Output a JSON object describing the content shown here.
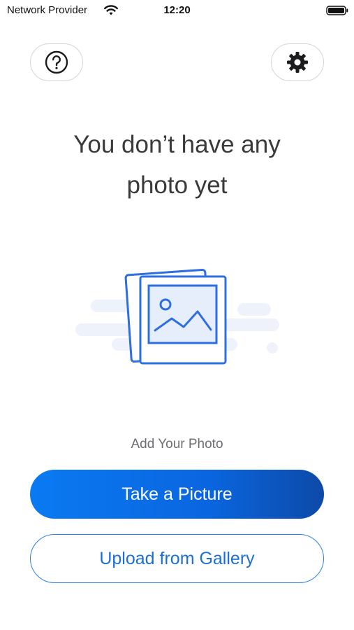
{
  "status_bar": {
    "carrier": "Network Provider",
    "time": "12:20",
    "wifi_icon": "wifi-icon",
    "battery_icon": "battery-icon"
  },
  "header": {
    "help_icon": "question-circle-icon",
    "settings_icon": "gear-icon"
  },
  "empty_state": {
    "title_line1": "You don’t have any",
    "title_line2": "photo yet",
    "illustration_icon": "photo-stack-icon",
    "add_label": "Add Your Photo"
  },
  "actions": {
    "take_picture": "Take a Picture",
    "upload_gallery": "Upload from Gallery"
  },
  "colors": {
    "primary": "#0a7af2",
    "primary_dark": "#0d4aa8",
    "outline": "#2b7fe6",
    "illustration_blue": "#2d6fe0"
  }
}
